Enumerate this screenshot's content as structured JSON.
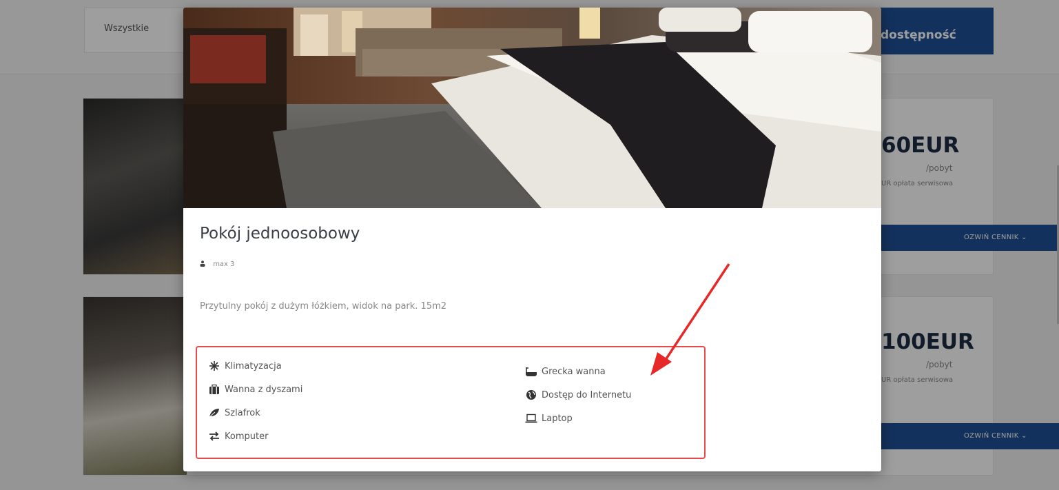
{
  "background": {
    "filter_label": "Wszystkie",
    "availability_button": "dostępność",
    "rooms": [
      {
        "price": "60EUR",
        "unit": "/pobyt",
        "fee": "UR opłata serwisowa",
        "button": "OZWIŃ CENNIK  ⌄"
      },
      {
        "price": "100EUR",
        "unit": "/pobyt",
        "fee": "UR opłata serwisowa",
        "button": "OZWIŃ CENNIK  ⌄"
      }
    ]
  },
  "modal": {
    "title": "Pokój jednoosobowy",
    "guests": "max 3",
    "description": "Przytulny pokój z dużym łóżkiem, widok na park. 15m2",
    "amenities_left": [
      {
        "label": "Klimatyzacja",
        "icon": "snowflake-icon"
      },
      {
        "label": "Wanna z dyszami",
        "icon": "suitcase-icon"
      },
      {
        "label": "Szlafrok",
        "icon": "leaf-icon"
      },
      {
        "label": "Komputer",
        "icon": "exchange-icon"
      }
    ],
    "amenities_right": [
      {
        "label": "Grecka wanna",
        "icon": "bathtub-icon"
      },
      {
        "label": "Dostęp do Internetu",
        "icon": "globe-icon"
      },
      {
        "label": "Laptop",
        "icon": "laptop-icon"
      }
    ]
  },
  "colors": {
    "accent_blue": "#1f4f97",
    "highlight_red": "#e64a4a",
    "title_dark": "#3a3f47"
  }
}
